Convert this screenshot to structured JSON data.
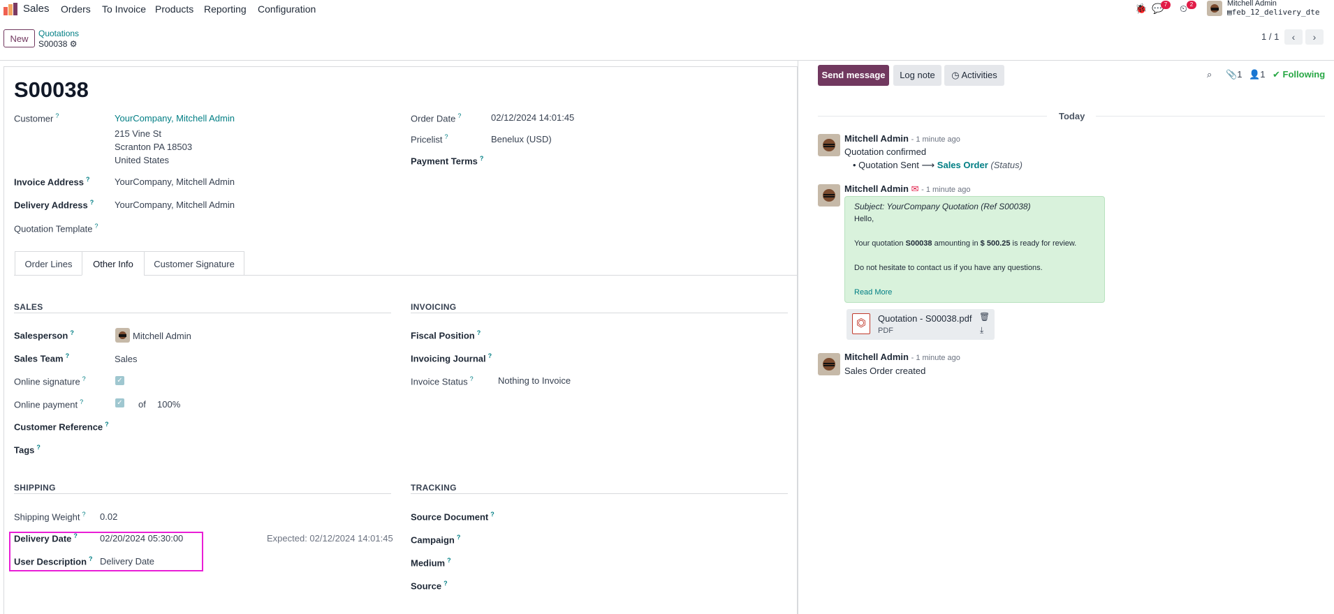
{
  "nav": {
    "app_name": "Sales",
    "menu": [
      "Orders",
      "To Invoice",
      "Products",
      "Reporting",
      "Configuration"
    ],
    "messages_badge": "7",
    "activities_badge": "2",
    "user_name": "Mitchell Admin",
    "db_name": "feb_12_delivery_dte"
  },
  "control": {
    "new_label": "New",
    "breadcrumb_parent": "Quotations",
    "breadcrumb_current": "S00038",
    "pager": "1 / 1"
  },
  "form": {
    "title": "S00038",
    "customer_label": "Customer",
    "customer_name": "YourCompany, Mitchell Admin",
    "customer_address": [
      "215 Vine St",
      "Scranton PA 18503",
      "United States"
    ],
    "invoice_address_label": "Invoice Address",
    "invoice_address": "YourCompany, Mitchell Admin",
    "delivery_address_label": "Delivery Address",
    "delivery_address": "YourCompany, Mitchell Admin",
    "quotation_template_label": "Quotation Template",
    "order_date_label": "Order Date",
    "order_date": "02/12/2024 14:01:45",
    "pricelist_label": "Pricelist",
    "pricelist": "Benelux (USD)",
    "payment_terms_label": "Payment Terms",
    "tabs": [
      "Order Lines",
      "Other Info",
      "Customer Signature"
    ],
    "sales": {
      "title": "SALES",
      "salesperson_label": "Salesperson",
      "salesperson": "Mitchell Admin",
      "sales_team_label": "Sales Team",
      "sales_team": "Sales",
      "online_signature_label": "Online signature",
      "online_payment_label": "Online payment",
      "of_label": "of",
      "payment_percent": "100%",
      "customer_reference_label": "Customer Reference",
      "tags_label": "Tags"
    },
    "invoicing": {
      "title": "INVOICING",
      "fiscal_position_label": "Fiscal Position",
      "invoicing_journal_label": "Invoicing Journal",
      "invoice_status_label": "Invoice Status",
      "invoice_status": "Nothing to Invoice"
    },
    "shipping": {
      "title": "SHIPPING",
      "weight_label": "Shipping Weight",
      "weight": "0.02",
      "delivery_date_label": "Delivery Date",
      "delivery_date": "02/20/2024 05:30:00",
      "expected": "Expected: 02/12/2024 14:01:45",
      "user_description_label": "User Description",
      "user_description": "Delivery Date"
    },
    "tracking": {
      "title": "TRACKING",
      "source_document_label": "Source Document",
      "campaign_label": "Campaign",
      "medium_label": "Medium",
      "source_label": "Source"
    }
  },
  "chatter": {
    "send_message": "Send message",
    "log_note": "Log note",
    "activities": "Activities",
    "attachments_count": "1",
    "followers_count": "1",
    "following": "Following",
    "today": "Today",
    "messages": [
      {
        "author": "Mitchell Admin",
        "time": "- 1 minute ago",
        "body": "Quotation confirmed",
        "tracking_old": "Quotation Sent",
        "tracking_new": "Sales Order",
        "tracking_field": "(Status)"
      },
      {
        "author": "Mitchell Admin",
        "time": "- 1 minute ago",
        "subject": "Subject: YourCompany Quotation (Ref S00038)",
        "greeting": "Hello,",
        "line1_pre": "Your quotation ",
        "line1_ref": "S00038",
        "line1_mid": " amounting in ",
        "line1_amount": "$ 500.25",
        "line1_post": " is ready for review.",
        "line2": "Do not hesitate to contact us if you have any questions.",
        "read_more": "Read More",
        "attachment_name": "Quotation - S00038.pdf",
        "attachment_type": "PDF"
      },
      {
        "author": "Mitchell Admin",
        "time": "- 1 minute ago",
        "body": "Sales Order created"
      }
    ]
  }
}
